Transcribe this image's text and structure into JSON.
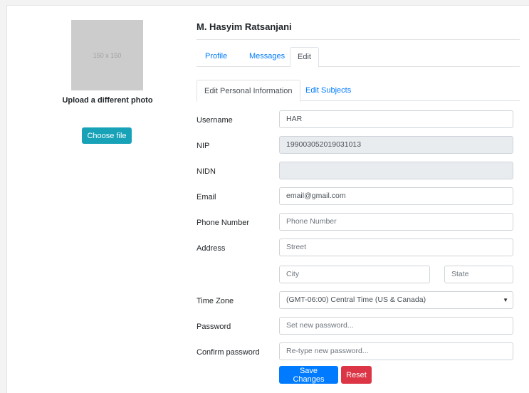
{
  "sidebar": {
    "photo_placeholder": "150 x 150",
    "upload_caption": "Upload a different photo",
    "choose_file_label": "Choose file"
  },
  "profile": {
    "name": "M. Hasyim Ratsanjani",
    "tabs": [
      {
        "label": "Profile",
        "active": false
      },
      {
        "label": "Messages",
        "active": false
      },
      {
        "label": "Edit",
        "active": true
      }
    ],
    "subtabs": [
      {
        "label": "Edit Personal Information",
        "active": true
      },
      {
        "label": "Edit Subjects",
        "active": false
      }
    ]
  },
  "form": {
    "username": {
      "label": "Username",
      "value": "HAR"
    },
    "nip": {
      "label": "NIP",
      "value": "199003052019031013"
    },
    "nidn": {
      "label": "NIDN",
      "value": ""
    },
    "email": {
      "label": "Email",
      "value": "email@gmail.com"
    },
    "phone": {
      "label": "Phone Number",
      "placeholder": "Phone Number"
    },
    "address": {
      "label": "Address",
      "street_placeholder": "Street",
      "city_placeholder": "City",
      "state_placeholder": "State"
    },
    "timezone": {
      "label": "Time Zone",
      "value": "(GMT-06:00) Central Time (US & Canada)"
    },
    "password": {
      "label": "Password",
      "placeholder": "Set new password..."
    },
    "confirm_password": {
      "label": "Confirm password",
      "placeholder": "Re-type new password..."
    }
  },
  "actions": {
    "save_label": "Save Changes",
    "reset_label": "Reset"
  },
  "colors": {
    "primary": "#007bff",
    "info": "#17a2b8",
    "danger": "#dc3545"
  }
}
